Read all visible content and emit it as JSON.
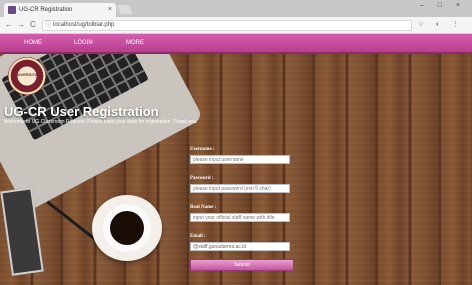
{
  "browser": {
    "tab_title": "UG-CR Registration",
    "tab_close": "×",
    "url": "localhost/ug/tolbiar.php",
    "window_controls": "– □ ×",
    "nav_back": "←",
    "nav_forward": "→",
    "nav_reload": "C",
    "toolbar_icons": "☆ ◐ ⋮"
  },
  "site_nav": {
    "items": [
      {
        "label": "HOME"
      },
      {
        "label": "LOGIN"
      },
      {
        "label": "MORE"
      }
    ],
    "accent": "#c24a99"
  },
  "logo": {
    "text": "UNIVERSITAS"
  },
  "page": {
    "title": "UG-CR User Registration",
    "subtitle": "Welcome to UG Classroom Request. Please input your data for registration. Thank you."
  },
  "form": {
    "username_label": "Username :",
    "username_placeholder": "please input username",
    "password_label": "Password :",
    "password_placeholder": "please input password (min 5 char)",
    "realname_label": "Real Name :",
    "realname_placeholder": "input your official staff name with title",
    "email_label": "Email :",
    "email_value": "@staff.gunadarma.ac.id",
    "submit_label": "Submit"
  }
}
